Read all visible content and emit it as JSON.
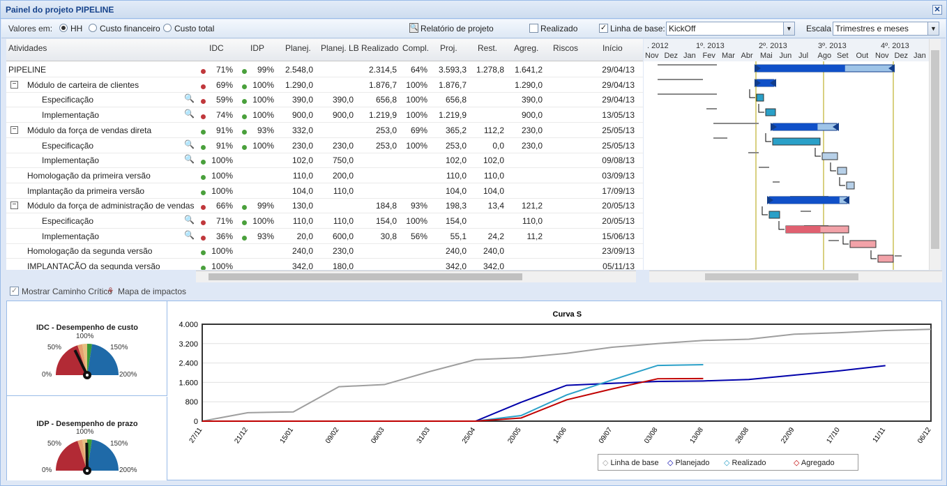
{
  "window": {
    "title": "Painel do projeto PIPELINE",
    "close_icon": "close-icon"
  },
  "toolbar": {
    "values_label": "Valores em:",
    "hh": "HH",
    "custo_fin": "Custo financeiro",
    "custo_total": "Custo total",
    "relatorio": "Relatório de projeto",
    "realizado": "Realizado",
    "linha_base": "Linha de base:",
    "linha_base_value": "KickOff",
    "escala": "Escala",
    "escala_value": "Trimestres e meses"
  },
  "columns": [
    "Atividades",
    "IDC",
    "IDP",
    "Planej.",
    "Planej. LB",
    "Realizado",
    "Compl.",
    "Proj.",
    "Rest.",
    "Agreg.",
    "Riscos",
    "Início"
  ],
  "rows": [
    {
      "name": "PIPELINE",
      "idc": "71%",
      "idp": "99%",
      "planej": "2.548,0",
      "planejlb": "",
      "real": "2.314,5",
      "compl": "64%",
      "proj": "3.593,3",
      "rest": "1.278,8",
      "agreg": "1.641,2",
      "inicio": "29/04/13"
    },
    {
      "name": "Módulo de carteira de clientes",
      "idc": "69%",
      "idp": "100%",
      "planej": "1.290,0",
      "planejlb": "",
      "real": "1.876,7",
      "compl": "100%",
      "proj": "1.876,7",
      "rest": "",
      "agreg": "1.290,0",
      "inicio": "29/04/13"
    },
    {
      "name": "Especificação",
      "idc": "59%",
      "idp": "100%",
      "planej": "390,0",
      "planejlb": "390,0",
      "real": "656,8",
      "compl": "100%",
      "proj": "656,8",
      "rest": "",
      "agreg": "390,0",
      "inicio": "29/04/13"
    },
    {
      "name": "Implementação",
      "idc": "74%",
      "idp": "100%",
      "planej": "900,0",
      "planejlb": "900,0",
      "real": "1.219,9",
      "compl": "100%",
      "proj": "1.219,9",
      "rest": "",
      "agreg": "900,0",
      "inicio": "13/05/13"
    },
    {
      "name": "Módulo da força de vendas direta",
      "idc": "91%",
      "idp": "93%",
      "planej": "332,0",
      "planejlb": "",
      "real": "253,0",
      "compl": "69%",
      "proj": "365,2",
      "rest": "112,2",
      "agreg": "230,0",
      "inicio": "25/05/13"
    },
    {
      "name": "Especificação",
      "idc": "91%",
      "idp": "100%",
      "planej": "230,0",
      "planejlb": "230,0",
      "real": "253,0",
      "compl": "100%",
      "proj": "253,0",
      "rest": "0,0",
      "agreg": "230,0",
      "inicio": "25/05/13"
    },
    {
      "name": "Implementação",
      "idc": "100%",
      "idp": "",
      "planej": "102,0",
      "planejlb": "750,0",
      "real": "",
      "compl": "",
      "proj": "102,0",
      "rest": "102,0",
      "agreg": "",
      "inicio": "09/08/13"
    },
    {
      "name": "Homologação da primeira versão",
      "idc": "100%",
      "idp": "",
      "planej": "110,0",
      "planejlb": "200,0",
      "real": "",
      "compl": "",
      "proj": "110,0",
      "rest": "110,0",
      "agreg": "",
      "inicio": "03/09/13"
    },
    {
      "name": "Implantação da primeira versão",
      "idc": "100%",
      "idp": "",
      "planej": "104,0",
      "planejlb": "110,0",
      "real": "",
      "compl": "",
      "proj": "104,0",
      "rest": "104,0",
      "agreg": "",
      "inicio": "17/09/13"
    },
    {
      "name": "Módulo da força de administração de vendas",
      "idc": "66%",
      "idp": "99%",
      "planej": "130,0",
      "planejlb": "",
      "real": "184,8",
      "compl": "93%",
      "proj": "198,3",
      "rest": "13,4",
      "agreg": "121,2",
      "inicio": "20/05/13"
    },
    {
      "name": "Especificação",
      "idc": "71%",
      "idp": "100%",
      "planej": "110,0",
      "planejlb": "110,0",
      "real": "154,0",
      "compl": "100%",
      "proj": "154,0",
      "rest": "",
      "agreg": "110,0",
      "inicio": "20/05/13"
    },
    {
      "name": "Implementação",
      "idc": "36%",
      "idp": "93%",
      "planej": "20,0",
      "planejlb": "600,0",
      "real": "30,8",
      "compl": "56%",
      "proj": "55,1",
      "rest": "24,2",
      "agreg": "11,2",
      "inicio": "15/06/13"
    },
    {
      "name": "Homologação da segunda versão",
      "idc": "100%",
      "idp": "",
      "planej": "240,0",
      "planejlb": "230,0",
      "real": "",
      "compl": "",
      "proj": "240,0",
      "rest": "240,0",
      "agreg": "",
      "inicio": "23/09/13"
    },
    {
      "name": "IMPLANTAÇÃO da segunda versão",
      "idc": "100%",
      "idp": "",
      "planej": "342,0",
      "planejlb": "180,0",
      "real": "",
      "compl": "",
      "proj": "342,0",
      "rest": "342,0",
      "agreg": "",
      "inicio": "05/11/13"
    }
  ],
  "gantt": {
    "quarters": [
      ". 2012",
      "1º. 2013",
      "2º. 2013",
      "3º. 2013",
      "4º. 2013"
    ],
    "months": [
      "Nov",
      "Dez",
      "Jan",
      "Fev",
      "Mar",
      "Abr",
      "Mai",
      "Jun",
      "Jul",
      "Ago",
      "Set",
      "Out",
      "Nov",
      "Dez",
      "Jan"
    ]
  },
  "bottom": {
    "caminho": "Mostrar Caminho Crítico",
    "mapa": "Mapa de impactos"
  },
  "gauges": [
    {
      "title": "IDC - Desempenho de custo",
      "l0": "0%",
      "l50": "50%",
      "l100": "100%",
      "l150": "150%",
      "l200": "200%",
      "value": 0.71
    },
    {
      "title": "IDP - Desempenho de prazo",
      "l0": "0%",
      "l50": "50%",
      "l100": "100%",
      "l150": "150%",
      "l200": "200%",
      "value": 0.99
    }
  ],
  "chart_data": {
    "type": "line",
    "title": "Curva S",
    "x": [
      "27/11",
      "21/12",
      "15/01",
      "09/02",
      "06/03",
      "31/03",
      "25/04",
      "20/05",
      "14/06",
      "09/07",
      "03/08",
      "13/08",
      "28/08",
      "22/09",
      "17/10",
      "11/11",
      "06/12"
    ],
    "ylim": [
      0,
      4000
    ],
    "yticks": [
      "0",
      "800",
      "1.600",
      "2.400",
      "3.200",
      "4.000"
    ],
    "series": [
      {
        "name": "Linha de base",
        "color": "#9e9e9e",
        "values": [
          0,
          350,
          380,
          1420,
          1510,
          2050,
          2540,
          2620,
          2800,
          3050,
          3200,
          3330,
          3380,
          3590,
          3650,
          3740,
          3790
        ]
      },
      {
        "name": "Planejado",
        "color": "#0000aa",
        "values": [
          0,
          0,
          0,
          0,
          0,
          0,
          0,
          780,
          1480,
          1560,
          1640,
          1660,
          1720,
          1900,
          2080,
          2290,
          null
        ]
      },
      {
        "name": "Realizado",
        "color": "#2aa0c8",
        "values": [
          0,
          0,
          0,
          0,
          0,
          0,
          0,
          230,
          1080,
          1700,
          2300,
          2330,
          null,
          null,
          null,
          null,
          null
        ]
      },
      {
        "name": "Agregado",
        "color": "#c00000",
        "values": [
          0,
          0,
          0,
          0,
          0,
          0,
          0,
          130,
          880,
          1330,
          1750,
          1760,
          null,
          null,
          null,
          null,
          null
        ]
      }
    ]
  }
}
